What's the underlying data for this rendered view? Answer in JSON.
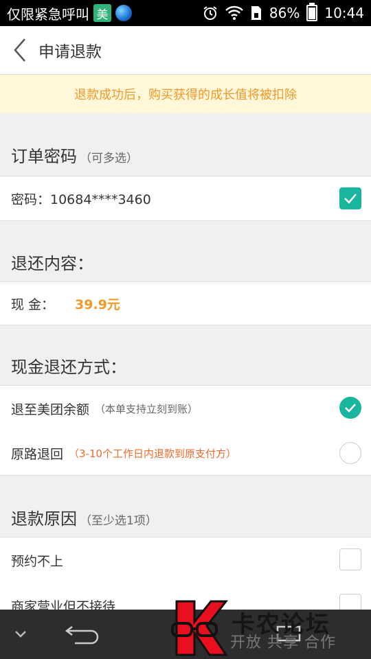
{
  "status_bar": {
    "carrier": "仅限紧急呼叫",
    "app_badge": "美",
    "battery": "86%",
    "battery_level": 0.86,
    "time": "10:44"
  },
  "header": {
    "title": "申请退款"
  },
  "notice": "退款成功后，购买获得的成长值将被扣除",
  "order_code_section": {
    "title": "订单密码",
    "hint": "（可多选）",
    "item_label": "密码：10684****3460",
    "checked": true
  },
  "refund_content_section": {
    "title": "退还内容：",
    "item_label": "现 金：",
    "amount": "39.9元"
  },
  "refund_method_section": {
    "title": "现金退还方式：",
    "options": [
      {
        "label": "退至美团余额",
        "note": "（本单支持立刻到账）",
        "checked": true
      },
      {
        "label": "原路退回",
        "note": "（3-10个工作日内退款到原支付方）",
        "checked": false
      }
    ]
  },
  "reason_section": {
    "title": "退款原因",
    "hint": "（至少选1项）",
    "options": [
      {
        "label": "预约不上",
        "checked": false
      },
      {
        "label": "商家营业但不接待",
        "checked": false
      }
    ]
  },
  "watermark": {
    "title": "卡农论坛",
    "subtitle": "开放 共享 合作"
  },
  "colors": {
    "accent": "#1ab59e",
    "price": "#f39826",
    "notice_bg": "#fff7da"
  }
}
